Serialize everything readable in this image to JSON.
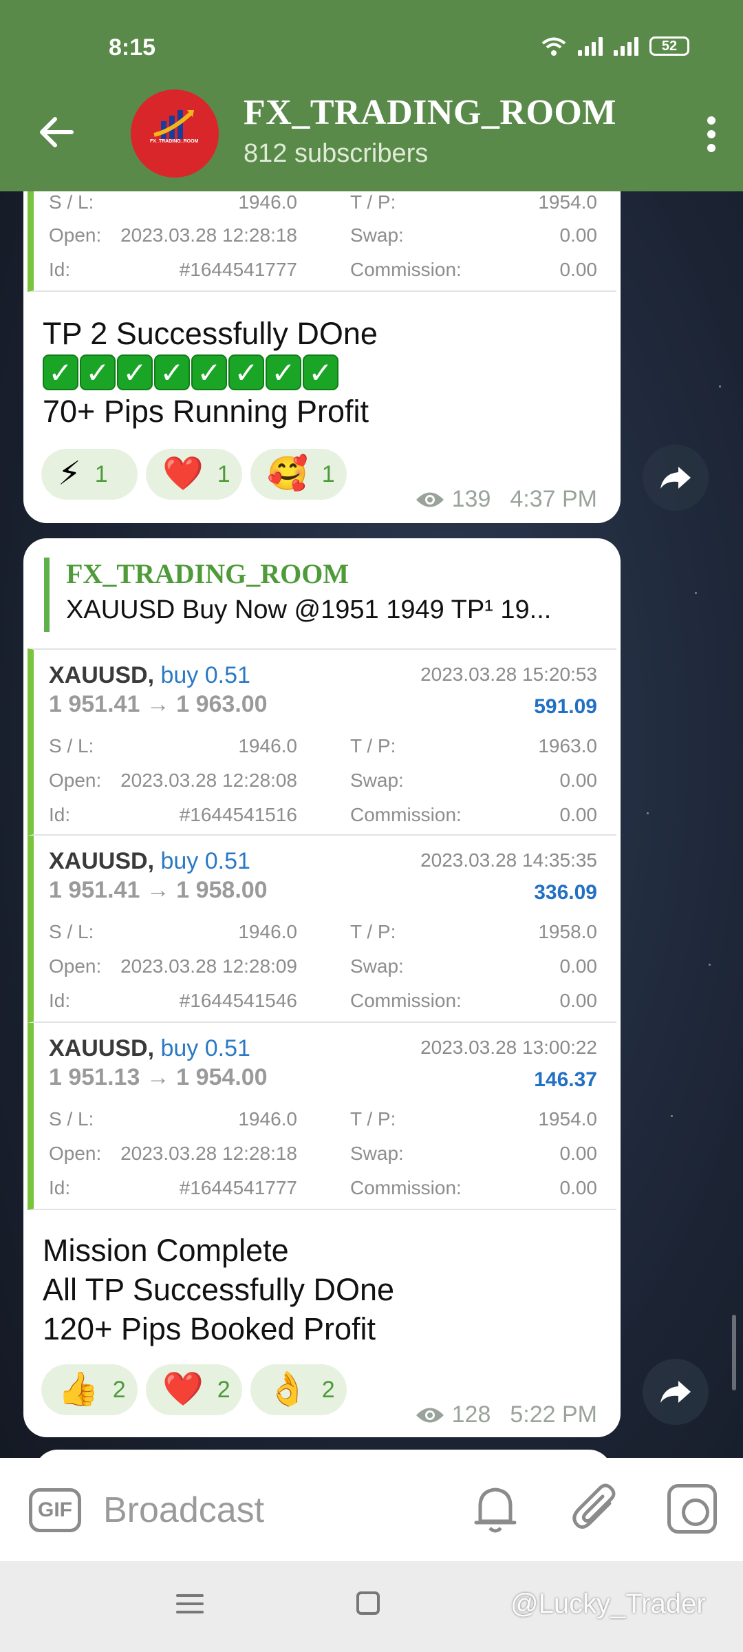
{
  "status_bar": {
    "time": "8:15",
    "battery": "52"
  },
  "header": {
    "title": "FX_TRADING_ROOM",
    "subtitle": "812 subscribers",
    "avatar_text": "FX_TRADING_ROOM"
  },
  "message1": {
    "trade": {
      "sl_label": "S / L:",
      "sl": "1946.0",
      "tp_label": "T / P:",
      "tp": "1954.0",
      "open_label": "Open:",
      "open": "2023.03.28 12:28:18",
      "swap_label": "Swap:",
      "swap": "0.00",
      "id_label": "Id:",
      "id": "#1644541777",
      "commission_label": "Commission:",
      "commission": "0.00"
    },
    "caption_line1": "TP 2 Successfully DOne",
    "checks": [
      "✓",
      "✓",
      "✓",
      "✓",
      "✓",
      "✓",
      "✓",
      "✓"
    ],
    "caption_line3": "70+ Pips Running Profit",
    "reactions": [
      {
        "emoji": "⚡",
        "count": "1"
      },
      {
        "emoji": "❤️",
        "count": "1"
      },
      {
        "emoji": "🥰",
        "count": "1"
      }
    ],
    "views": "139",
    "time": "4:37 PM"
  },
  "message2": {
    "reply": {
      "author": "FX_TRADING_ROOM",
      "text": "XAUUSD Buy Now @1951 1949  TP¹  19..."
    },
    "trades": [
      {
        "symbol": "XAUUSD,",
        "side": "buy 0.51",
        "date": "2023.03.28 15:20:53",
        "price": "1 951.41 → 1 963.00",
        "profit": "591.09",
        "sl_label": "S / L:",
        "sl": "1946.0",
        "tp_label": "T / P:",
        "tp": "1963.0",
        "open_label": "Open:",
        "open": "2023.03.28 12:28:08",
        "swap_label": "Swap:",
        "swap": "0.00",
        "id_label": "Id:",
        "id": "#1644541516",
        "commission_label": "Commission:",
        "commission": "0.00"
      },
      {
        "symbol": "XAUUSD,",
        "side": "buy 0.51",
        "date": "2023.03.28 14:35:35",
        "price": "1 951.41 → 1 958.00",
        "profit": "336.09",
        "sl_label": "S / L:",
        "sl": "1946.0",
        "tp_label": "T / P:",
        "tp": "1958.0",
        "open_label": "Open:",
        "open": "2023.03.28 12:28:09",
        "swap_label": "Swap:",
        "swap": "0.00",
        "id_label": "Id:",
        "id": "#1644541546",
        "commission_label": "Commission:",
        "commission": "0.00"
      },
      {
        "symbol": "XAUUSD,",
        "side": "buy 0.51",
        "date": "2023.03.28 13:00:22",
        "price": "1 951.13 → 1 954.00",
        "profit": "146.37",
        "sl_label": "S / L:",
        "sl": "1946.0",
        "tp_label": "T / P:",
        "tp": "1954.0",
        "open_label": "Open:",
        "open": "2023.03.28 12:28:18",
        "swap_label": "Swap:",
        "swap": "0.00",
        "id_label": "Id:",
        "id": "#1644541777",
        "commission_label": "Commission:",
        "commission": "0.00"
      }
    ],
    "caption_line1": "Mission Complete",
    "caption_line2": "All TP Successfully DOne",
    "caption_line3": "120+ Pips Booked Profit",
    "reactions": [
      {
        "emoji": "👍",
        "count": "2"
      },
      {
        "emoji": "❤️",
        "count": "2"
      },
      {
        "emoji": "👌",
        "count": "2"
      }
    ],
    "views": "128",
    "time": "5:22 PM"
  },
  "composer": {
    "gif_label": "GIF",
    "placeholder": "Broadcast"
  },
  "watermark": "@Lucky_Trader",
  "colors": {
    "header": "#5a8a4a",
    "accent_green": "#79c43c",
    "profit_blue": "#2270c4"
  }
}
